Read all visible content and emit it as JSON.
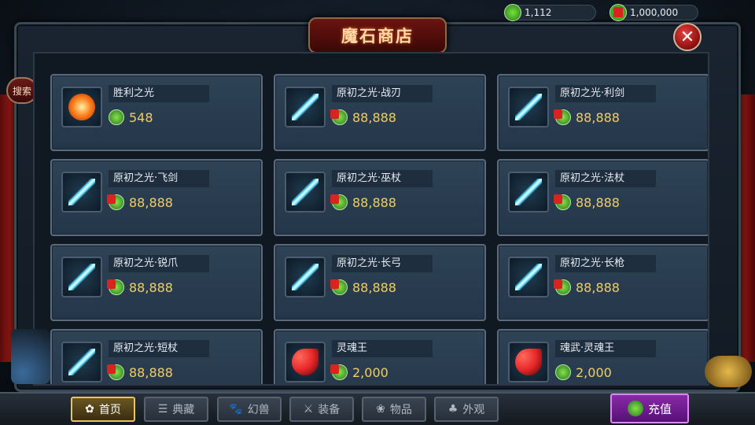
{
  "header": {
    "title": "魔石商店",
    "currency": [
      {
        "icon": "magic-stone-icon",
        "bound": false,
        "amount": "1,112"
      },
      {
        "icon": "bound-magic-stone-icon",
        "bound": true,
        "amount": "1,000,000"
      }
    ],
    "close_icon": "close-icon"
  },
  "side": {
    "search_label": "搜索"
  },
  "items": [
    {
      "name": "胜利之光",
      "price": "548",
      "bound": false,
      "icon": "sun-orb-icon",
      "color": "#ff7a1a"
    },
    {
      "name": "原初之光·战刃",
      "price": "88,888",
      "bound": true,
      "icon": "blade-icon",
      "color": "#5ad8ff"
    },
    {
      "name": "原初之光·利剑",
      "price": "88,888",
      "bound": true,
      "icon": "sword-icon",
      "color": "#5ad8ff"
    },
    {
      "name": "原初之光·飞剑",
      "price": "88,888",
      "bound": true,
      "icon": "flying-sword-icon",
      "color": "#5ad8ff"
    },
    {
      "name": "原初之光·巫杖",
      "price": "88,888",
      "bound": true,
      "icon": "wizard-staff-icon",
      "color": "#5ad8ff"
    },
    {
      "name": "原初之光·法杖",
      "price": "88,888",
      "bound": true,
      "icon": "magic-staff-icon",
      "color": "#5ad8ff"
    },
    {
      "name": "原初之光·锐爪",
      "price": "88,888",
      "bound": true,
      "icon": "claw-icon",
      "color": "#5ad8ff"
    },
    {
      "name": "原初之光·长弓",
      "price": "88,888",
      "bound": true,
      "icon": "bow-icon",
      "color": "#5ad8ff"
    },
    {
      "name": "原初之光·长枪",
      "price": "88,888",
      "bound": true,
      "icon": "spear-icon",
      "color": "#5ad8ff"
    },
    {
      "name": "原初之光·短杖",
      "price": "88,888",
      "bound": true,
      "icon": "short-staff-icon",
      "color": "#5ad8ff"
    },
    {
      "name": "灵魂王",
      "price": "2,000",
      "bound": true,
      "icon": "soul-king-icon",
      "color": "#e8282a"
    },
    {
      "name": "魂武·灵魂王",
      "price": "2,000",
      "bound": false,
      "icon": "soul-weapon-icon",
      "color": "#e8282a"
    }
  ],
  "nav": [
    {
      "label": "首页",
      "icon": "home-icon",
      "active": true
    },
    {
      "label": "典藏",
      "icon": "collection-icon",
      "active": false
    },
    {
      "label": "幻兽",
      "icon": "beast-icon",
      "active": false
    },
    {
      "label": "装备",
      "icon": "equipment-icon",
      "active": false
    },
    {
      "label": "物品",
      "icon": "item-icon",
      "active": false
    },
    {
      "label": "外观",
      "icon": "appearance-icon",
      "active": false
    }
  ],
  "recharge": {
    "label": "充值",
    "icon": "magic-stone-icon"
  }
}
